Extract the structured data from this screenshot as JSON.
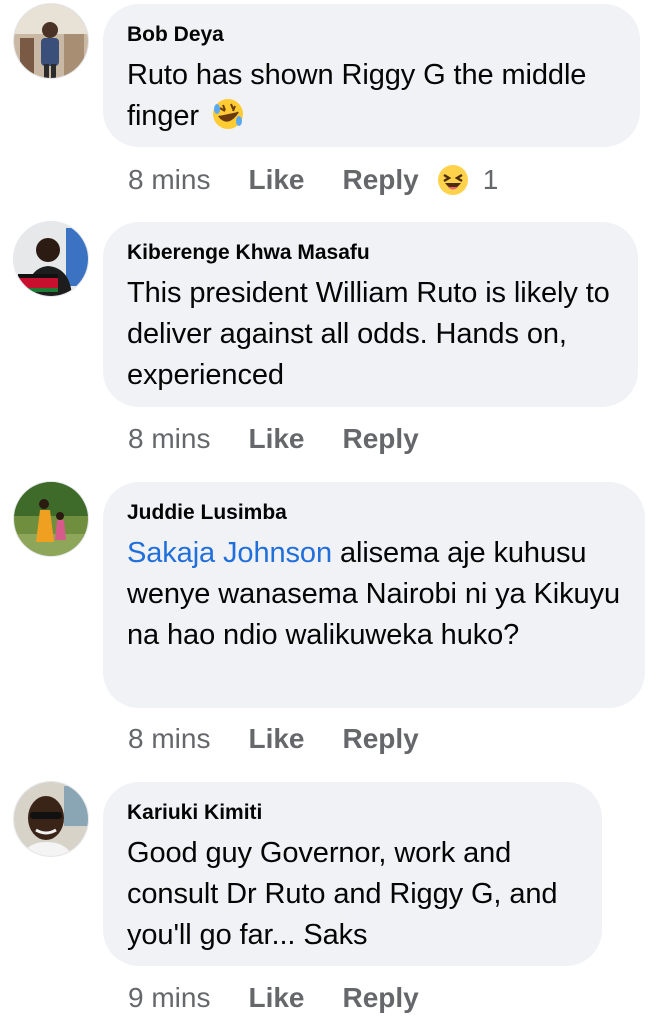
{
  "comments": [
    {
      "author": "Bob Deya",
      "text": "Ruto has shown Riggy G the middle finger",
      "emoji": "rolling-on-floor-laughing",
      "time": "8 mins",
      "like": "Like",
      "reply": "Reply",
      "reaction": "haha",
      "reaction_count": "1"
    },
    {
      "author": "Kiberenge Khwa Masafu",
      "text": "This president William Ruto is likely to deliver against all odds. Hands on, experienced",
      "time": "8 mins",
      "like": "Like",
      "reply": "Reply"
    },
    {
      "author": "Juddie Lusimba",
      "mention": "Sakaja Johnson",
      "text": " alisema aje kuhusu wenye wanasema Nairobi ni ya Kikuyu na hao ndio walikuweka huko?",
      "time": "8 mins",
      "like": "Like",
      "reply": "Reply"
    },
    {
      "author": "Kariuki Kimiti",
      "text": "Good guy Governor, work and consult Dr Ruto and Riggy G, and you'll go far... Saks",
      "time": "9 mins",
      "like": "Like",
      "reply": "Reply"
    }
  ],
  "colors": {
    "bubble": "#f0f2f5",
    "meta": "#65676b",
    "mention": "#216fdb",
    "text": "#050505"
  }
}
